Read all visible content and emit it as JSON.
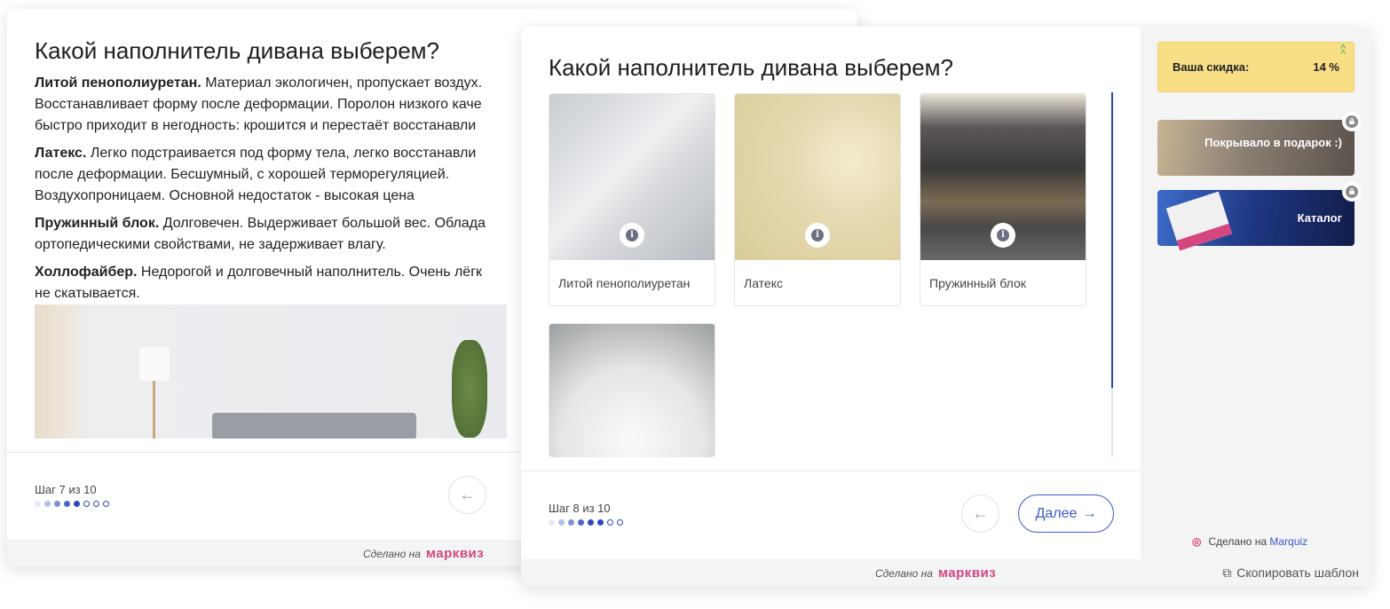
{
  "back_quiz": {
    "title": "Какой наполнитель дивана выберем?",
    "paragraphs": [
      {
        "bold": "Литой пенополиуретан.",
        "lines": [
          " Материал экологичен, пропускает воздух.",
          "Восстанавливает форму после деформации. Поролон низкого каче",
          "быстро приходит в негодность: крошится и перестаёт восстанавли"
        ]
      },
      {
        "bold": "Латекс.",
        "lines": [
          " Легко подстраивается под форму тела, легко восстанавли",
          "после деформации. Бесшумный, с хорошей терморегуляцией.",
          "Воздухопроницаем. Основной недостаток - высокая цена"
        ]
      },
      {
        "bold": "Пружинный блок.",
        "lines": [
          " Долговечен. Выдерживает большой вес. Облада",
          "ортопедическими свойствами, не задерживает влагу."
        ]
      },
      {
        "bold": "Холлофайбер.",
        "lines": [
          " Недорогой и долговечный наполнитель. Очень лёгк",
          "не скатывается."
        ]
      }
    ],
    "step_label": "Шаг 7 из 10",
    "progress": {
      "current": 7,
      "total": 10
    },
    "made_with": "Сделано на",
    "brand": "марквиз"
  },
  "front_quiz": {
    "title": "Какой наполнитель дивана выберем?",
    "options": [
      {
        "label": "Литой пенополиуретан"
      },
      {
        "label": "Латекс"
      },
      {
        "label": "Пружинный блок"
      },
      {
        "label": ""
      }
    ],
    "step_label": "Шаг 8 из 10",
    "progress": {
      "current": 8,
      "total": 10
    },
    "next_label": "Далее",
    "sidebar": {
      "discount_label": "Ваша скидка:",
      "discount_value": "14 %",
      "bonuses": [
        {
          "label": "Покрывало в подарок :)"
        },
        {
          "label": "Каталог"
        }
      ],
      "made_with": "Сделано на",
      "marquiz": "Marquiz"
    },
    "made_with": "Сделано на",
    "brand": "марквиз",
    "copy_template": "Скопировать шаблон"
  },
  "colors": {
    "accent": "#3a5bc7",
    "brand": "#d5477f",
    "discount": "#f8de85"
  }
}
